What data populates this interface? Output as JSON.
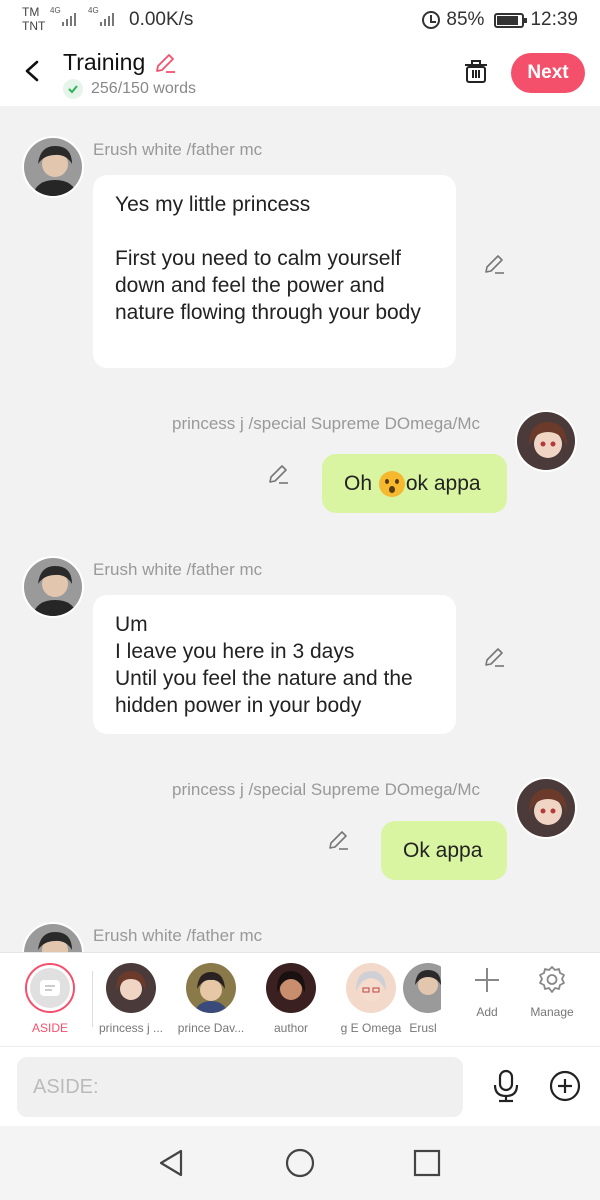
{
  "status_bar": {
    "carrier_top": "TM",
    "carrier_bottom": "TNT",
    "network_1": "4G",
    "network_2": "4G",
    "speed": "0.00K/s",
    "battery": "85%",
    "time": "12:39"
  },
  "header": {
    "title": "Training",
    "word_count": "256/150 words",
    "next_label": "Next"
  },
  "messages": [
    {
      "sender": "Erush white /father mc",
      "side": "left",
      "text": "Yes my little princess\n\nFirst you need to calm yourself down and feel the power and nature flowing through your body"
    },
    {
      "sender": "princess j /special Supreme DOmega/Mc",
      "side": "right",
      "text_before_emoji": "Oh ",
      "emoji": "astonished-face",
      "text_after_emoji": "ok appa"
    },
    {
      "sender": "Erush white /father mc",
      "side": "left",
      "text": "Um\nI leave you here in 3 days\nUntil you feel the nature and the hidden power in your body"
    },
    {
      "sender": "princess j /special Supreme DOmega/Mc",
      "side": "right",
      "text": "Ok appa"
    },
    {
      "sender": "Erush white /father mc",
      "side": "left",
      "text": ""
    }
  ],
  "characters": {
    "aside": "ASIDE",
    "items": [
      "princess j ...",
      "prince Dav...",
      "author",
      "g E Omega",
      "Erusl"
    ],
    "add": "Add",
    "manage": "Manage"
  },
  "input": {
    "placeholder": "ASIDE:"
  },
  "colors": {
    "accent": "#f4506b",
    "my_bubble": "#d9f5a1",
    "other_bubble": "#ffffff",
    "background": "#f2f2f2"
  }
}
